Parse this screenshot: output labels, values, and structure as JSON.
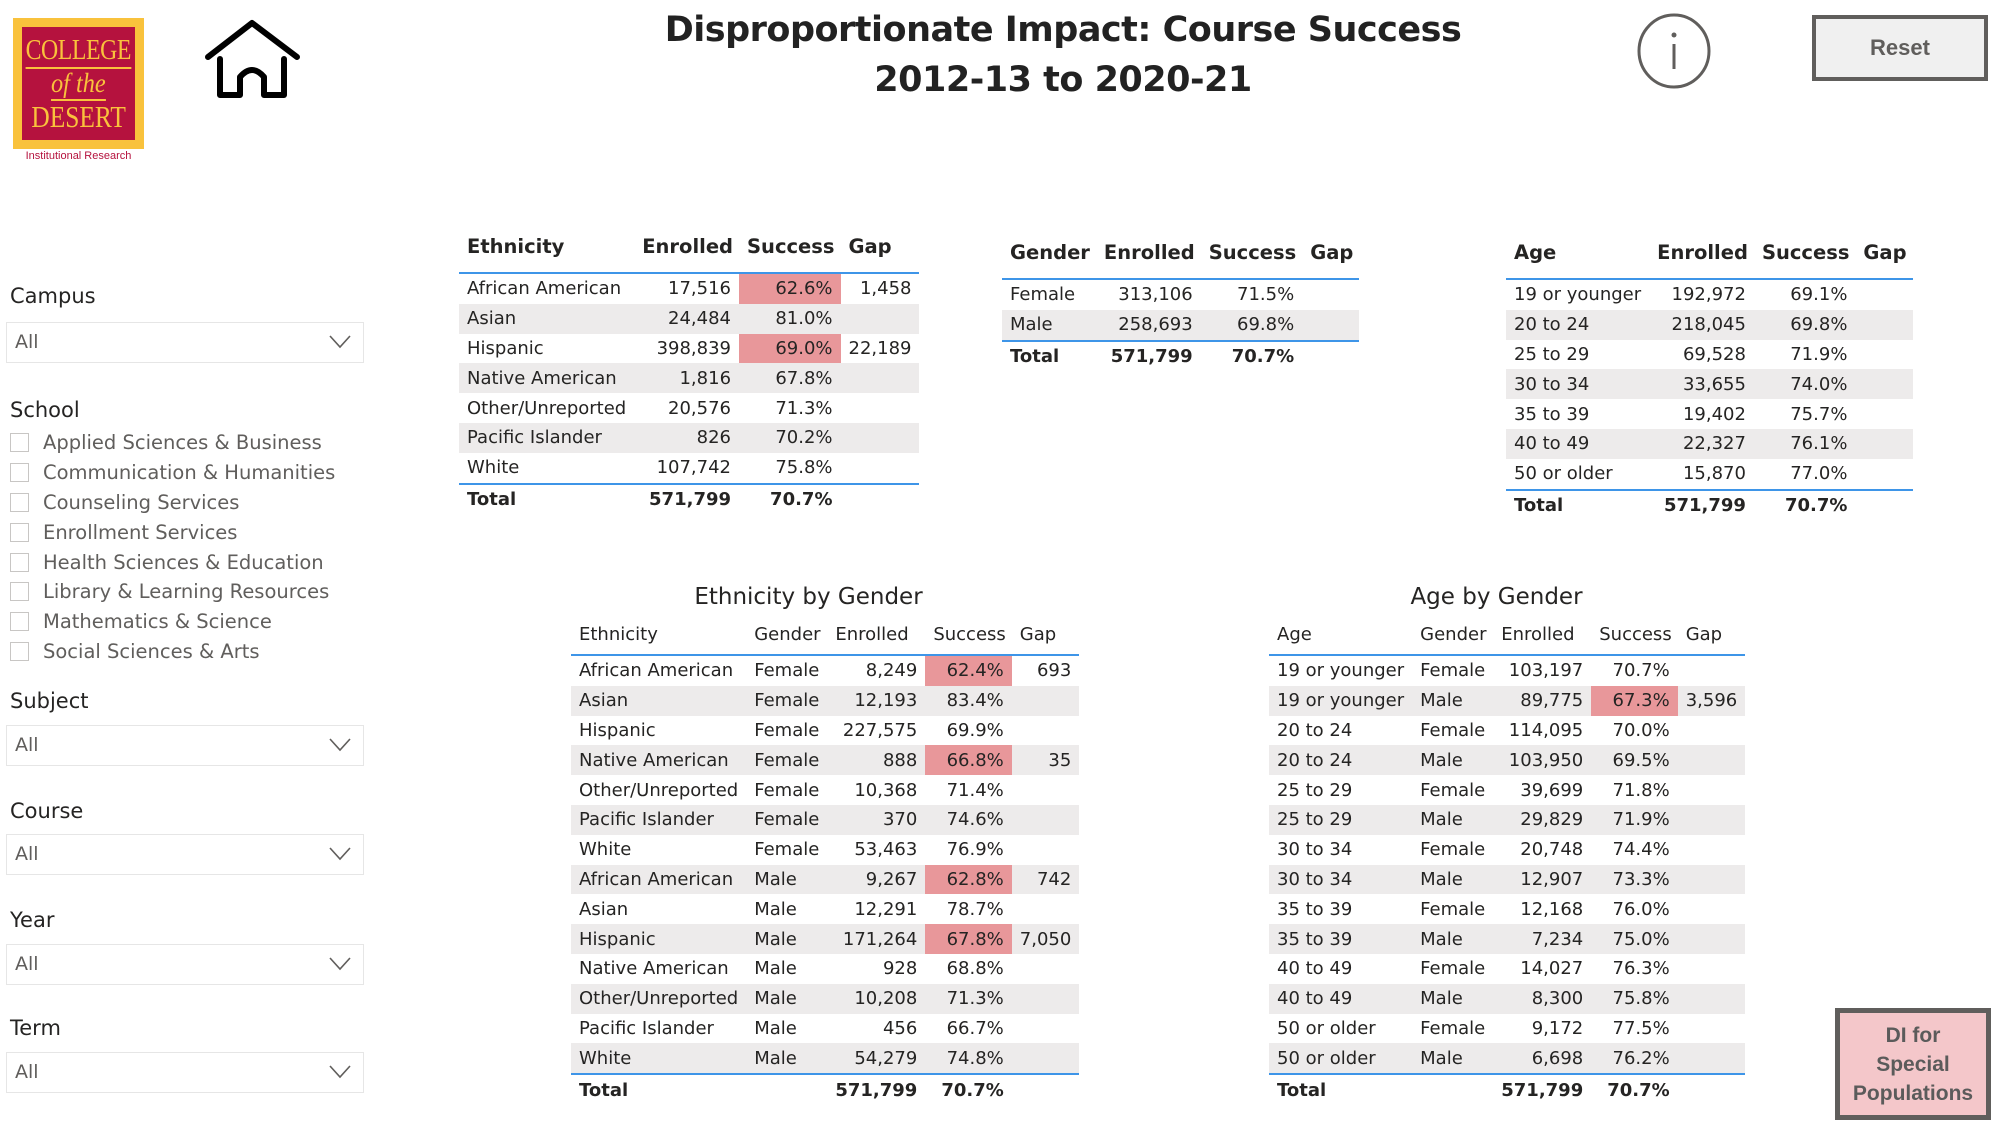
{
  "header": {
    "logo": {
      "line1": "COLLEGE",
      "line2": "of the",
      "line3": "DESERT",
      "subtitle": "Institutional Research"
    },
    "title_line1": "Disproportionate Impact: Course Success",
    "title_line2": "2012-13 to 2020-21",
    "reset_label": "Reset",
    "icons": {
      "home": "home-icon",
      "info": "info-icon"
    }
  },
  "colors": {
    "highlight": "#E8979A",
    "stripe": "#EDEBEB",
    "accent_line": "#3E95E8",
    "logo_red": "#B5123E",
    "logo_gold": "#F9C23C",
    "special_button_bg": "#F4C7CA"
  },
  "filters": {
    "campus": {
      "label": "Campus",
      "value": "All"
    },
    "school": {
      "label": "School",
      "options": [
        "Applied Sciences & Business",
        "Communication & Humanities",
        "Counseling Services",
        "Enrollment Services",
        "Health Sciences & Education",
        "Library & Learning Resources",
        "Mathematics & Science",
        "Social Sciences & Arts"
      ]
    },
    "subject": {
      "label": "Subject",
      "value": "All"
    },
    "course": {
      "label": "Course",
      "value": "All"
    },
    "year": {
      "label": "Year",
      "value": "All"
    },
    "term": {
      "label": "Term",
      "value": "All"
    }
  },
  "ethnicity_table": {
    "headers": [
      "Ethnicity",
      "Enrolled",
      "Success",
      "Gap"
    ],
    "rows": [
      {
        "group": "African American",
        "enrolled": "17,516",
        "success": "62.6%",
        "gap": "1,458",
        "highlight": true
      },
      {
        "group": "Asian",
        "enrolled": "24,484",
        "success": "81.0%",
        "gap": "",
        "highlight": false
      },
      {
        "group": "Hispanic",
        "enrolled": "398,839",
        "success": "69.0%",
        "gap": "22,189",
        "highlight": true
      },
      {
        "group": "Native American",
        "enrolled": "1,816",
        "success": "67.8%",
        "gap": "",
        "highlight": false
      },
      {
        "group": "Other/Unreported",
        "enrolled": "20,576",
        "success": "71.3%",
        "gap": "",
        "highlight": false
      },
      {
        "group": "Pacific Islander",
        "enrolled": "826",
        "success": "70.2%",
        "gap": "",
        "highlight": false
      },
      {
        "group": "White",
        "enrolled": "107,742",
        "success": "75.8%",
        "gap": "",
        "highlight": false
      }
    ],
    "total": {
      "label": "Total",
      "enrolled": "571,799",
      "success": "70.7%"
    }
  },
  "gender_table": {
    "headers": [
      "Gender",
      "Enrolled",
      "Success",
      "Gap"
    ],
    "rows": [
      {
        "group": "Female",
        "enrolled": "313,106",
        "success": "71.5%",
        "gap": "",
        "highlight": false
      },
      {
        "group": "Male",
        "enrolled": "258,693",
        "success": "69.8%",
        "gap": "",
        "highlight": false
      }
    ],
    "total": {
      "label": "Total",
      "enrolled": "571,799",
      "success": "70.7%"
    }
  },
  "age_table": {
    "headers": [
      "Age",
      "Enrolled",
      "Success",
      "Gap"
    ],
    "rows": [
      {
        "group": "19 or younger",
        "enrolled": "192,972",
        "success": "69.1%",
        "gap": "",
        "highlight": false
      },
      {
        "group": "20 to 24",
        "enrolled": "218,045",
        "success": "69.8%",
        "gap": "",
        "highlight": false
      },
      {
        "group": "25 to 29",
        "enrolled": "69,528",
        "success": "71.9%",
        "gap": "",
        "highlight": false
      },
      {
        "group": "30 to 34",
        "enrolled": "33,655",
        "success": "74.0%",
        "gap": "",
        "highlight": false
      },
      {
        "group": "35 to 39",
        "enrolled": "19,402",
        "success": "75.7%",
        "gap": "",
        "highlight": false
      },
      {
        "group": "40 to 49",
        "enrolled": "22,327",
        "success": "76.1%",
        "gap": "",
        "highlight": false
      },
      {
        "group": "50 or older",
        "enrolled": "15,870",
        "success": "77.0%",
        "gap": "",
        "highlight": false
      }
    ],
    "total": {
      "label": "Total",
      "enrolled": "571,799",
      "success": "70.7%"
    }
  },
  "ethnicity_by_gender": {
    "title": "Ethnicity by Gender",
    "headers": [
      "Ethnicity",
      "Gender",
      "Enrolled",
      "Success",
      "Gap"
    ],
    "rows": [
      {
        "group": "African American",
        "gender": "Female",
        "enrolled": "8,249",
        "success": "62.4%",
        "gap": "693",
        "highlight": true
      },
      {
        "group": "Asian",
        "gender": "Female",
        "enrolled": "12,193",
        "success": "83.4%",
        "gap": "",
        "highlight": false
      },
      {
        "group": "Hispanic",
        "gender": "Female",
        "enrolled": "227,575",
        "success": "69.9%",
        "gap": "",
        "highlight": false
      },
      {
        "group": "Native American",
        "gender": "Female",
        "enrolled": "888",
        "success": "66.8%",
        "gap": "35",
        "highlight": true
      },
      {
        "group": "Other/Unreported",
        "gender": "Female",
        "enrolled": "10,368",
        "success": "71.4%",
        "gap": "",
        "highlight": false
      },
      {
        "group": "Pacific Islander",
        "gender": "Female",
        "enrolled": "370",
        "success": "74.6%",
        "gap": "",
        "highlight": false
      },
      {
        "group": "White",
        "gender": "Female",
        "enrolled": "53,463",
        "success": "76.9%",
        "gap": "",
        "highlight": false
      },
      {
        "group": "African American",
        "gender": "Male",
        "enrolled": "9,267",
        "success": "62.8%",
        "gap": "742",
        "highlight": true
      },
      {
        "group": "Asian",
        "gender": "Male",
        "enrolled": "12,291",
        "success": "78.7%",
        "gap": "",
        "highlight": false
      },
      {
        "group": "Hispanic",
        "gender": "Male",
        "enrolled": "171,264",
        "success": "67.8%",
        "gap": "7,050",
        "highlight": true
      },
      {
        "group": "Native American",
        "gender": "Male",
        "enrolled": "928",
        "success": "68.8%",
        "gap": "",
        "highlight": false
      },
      {
        "group": "Other/Unreported",
        "gender": "Male",
        "enrolled": "10,208",
        "success": "71.3%",
        "gap": "",
        "highlight": false
      },
      {
        "group": "Pacific Islander",
        "gender": "Male",
        "enrolled": "456",
        "success": "66.7%",
        "gap": "",
        "highlight": false
      },
      {
        "group": "White",
        "gender": "Male",
        "enrolled": "54,279",
        "success": "74.8%",
        "gap": "",
        "highlight": false
      }
    ],
    "total": {
      "label": "Total",
      "enrolled": "571,799",
      "success": "70.7%"
    }
  },
  "age_by_gender": {
    "title": "Age by Gender",
    "headers": [
      "Age",
      "Gender",
      "Enrolled",
      "Success",
      "Gap"
    ],
    "rows": [
      {
        "group": "19 or younger",
        "gender": "Female",
        "enrolled": "103,197",
        "success": "70.7%",
        "gap": "",
        "highlight": false
      },
      {
        "group": "19 or younger",
        "gender": "Male",
        "enrolled": "89,775",
        "success": "67.3%",
        "gap": "3,596",
        "highlight": true
      },
      {
        "group": "20 to 24",
        "gender": "Female",
        "enrolled": "114,095",
        "success": "70.0%",
        "gap": "",
        "highlight": false
      },
      {
        "group": "20 to 24",
        "gender": "Male",
        "enrolled": "103,950",
        "success": "69.5%",
        "gap": "",
        "highlight": false
      },
      {
        "group": "25 to 29",
        "gender": "Female",
        "enrolled": "39,699",
        "success": "71.8%",
        "gap": "",
        "highlight": false
      },
      {
        "group": "25 to 29",
        "gender": "Male",
        "enrolled": "29,829",
        "success": "71.9%",
        "gap": "",
        "highlight": false
      },
      {
        "group": "30 to 34",
        "gender": "Female",
        "enrolled": "20,748",
        "success": "74.4%",
        "gap": "",
        "highlight": false
      },
      {
        "group": "30 to 34",
        "gender": "Male",
        "enrolled": "12,907",
        "success": "73.3%",
        "gap": "",
        "highlight": false
      },
      {
        "group": "35 to 39",
        "gender": "Female",
        "enrolled": "12,168",
        "success": "76.0%",
        "gap": "",
        "highlight": false
      },
      {
        "group": "35 to 39",
        "gender": "Male",
        "enrolled": "7,234",
        "success": "75.0%",
        "gap": "",
        "highlight": false
      },
      {
        "group": "40 to 49",
        "gender": "Female",
        "enrolled": "14,027",
        "success": "76.3%",
        "gap": "",
        "highlight": false
      },
      {
        "group": "40 to 49",
        "gender": "Male",
        "enrolled": "8,300",
        "success": "75.8%",
        "gap": "",
        "highlight": false
      },
      {
        "group": "50 or older",
        "gender": "Female",
        "enrolled": "9,172",
        "success": "77.5%",
        "gap": "",
        "highlight": false
      },
      {
        "group": "50 or older",
        "gender": "Male",
        "enrolled": "6,698",
        "success": "76.2%",
        "gap": "",
        "highlight": false
      }
    ],
    "total": {
      "label": "Total",
      "enrolled": "571,799",
      "success": "70.7%"
    }
  },
  "special_populations_button": {
    "line1": "DI for",
    "line2": "Special",
    "line3": "Populations"
  }
}
